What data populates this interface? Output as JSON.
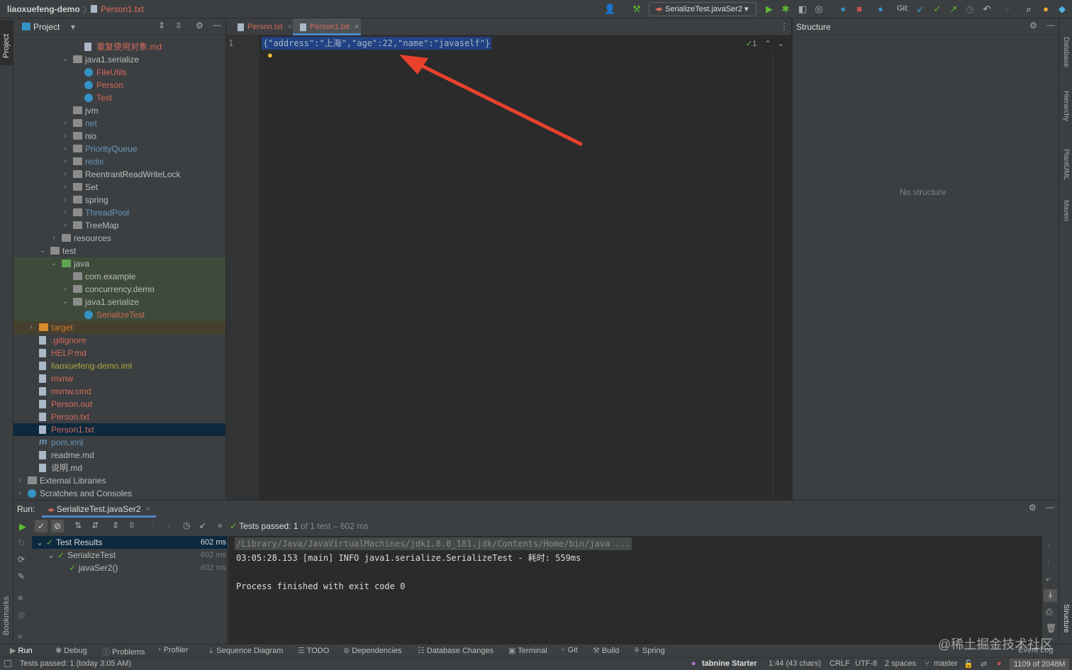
{
  "titlebar": {
    "project": "liaoxuefeng-demo",
    "file": "Person1.txt",
    "run_config": "SerializeTest.javaSer2",
    "git_label": "Git:"
  },
  "sidebar_left": {
    "project_label": "Project",
    "bookmarks_label": "Bookmarks"
  },
  "sidebar_right": {
    "database": "Database",
    "hierarchy": "Hierarchy",
    "plantuml": "PlantUML",
    "maven": "Maven",
    "structure": "Structure"
  },
  "project_panel": {
    "title": "Project",
    "tree": [
      {
        "label": "重复使用对象.md",
        "color": "#d36a5c",
        "kind": "doc"
      },
      {
        "label": "java1.serialize",
        "color": "#bbbbbb",
        "kind": "folder"
      },
      {
        "label": "FileUtils",
        "color": "#d36a5c",
        "kind": "class"
      },
      {
        "label": "Person",
        "color": "#d36a5c",
        "kind": "class"
      },
      {
        "label": "Test",
        "color": "#d36a5c",
        "kind": "class"
      },
      {
        "label": "jvm",
        "color": "#bbbbbb",
        "kind": "folder"
      },
      {
        "label": "net",
        "color": "#6897bb",
        "kind": "folder"
      },
      {
        "label": "nio",
        "color": "#bbbbbb",
        "kind": "folder"
      },
      {
        "label": "PriorityQueue",
        "color": "#6897bb",
        "kind": "folder"
      },
      {
        "label": "redis",
        "color": "#6897bb",
        "kind": "folder"
      },
      {
        "label": "ReentrantReadWriteLock",
        "color": "#bbbbbb",
        "kind": "folder"
      },
      {
        "label": "Set",
        "color": "#bbbbbb",
        "kind": "folder"
      },
      {
        "label": "spring",
        "color": "#bbbbbb",
        "kind": "folder"
      },
      {
        "label": "ThreadPool",
        "color": "#6897bb",
        "kind": "folder"
      },
      {
        "label": "TreeMap",
        "color": "#bbbbbb",
        "kind": "folder"
      },
      {
        "label": "resources",
        "color": "#bbbbbb",
        "kind": "folder"
      },
      {
        "label": "test",
        "color": "#bbbbbb",
        "kind": "folder"
      },
      {
        "label": "java",
        "color": "#bbbbbb",
        "kind": "folder"
      },
      {
        "label": "com.example",
        "color": "#bbbbbb",
        "kind": "folder"
      },
      {
        "label": "concurrency.demo",
        "color": "#bbbbbb",
        "kind": "folder"
      },
      {
        "label": "java1.serialize",
        "color": "#bbbbbb",
        "kind": "folder"
      },
      {
        "label": "SerializeTest",
        "color": "#d36a5c",
        "kind": "class"
      },
      {
        "label": "target",
        "color": "#d07a28",
        "kind": "folder"
      },
      {
        "label": ".gitignore",
        "color": "#d36a5c",
        "kind": "doc"
      },
      {
        "label": "HELP.md",
        "color": "#d36a5c",
        "kind": "doc"
      },
      {
        "label": "liaoxuefeng-demo.iml",
        "color": "#a8a841",
        "kind": "doc"
      },
      {
        "label": "mvnw",
        "color": "#d36a5c",
        "kind": "doc"
      },
      {
        "label": "mvnw.cmd",
        "color": "#d36a5c",
        "kind": "doc"
      },
      {
        "label": "Person.out",
        "color": "#d36a5c",
        "kind": "doc"
      },
      {
        "label": "Person.txt",
        "color": "#d36a5c",
        "kind": "doc"
      },
      {
        "label": "Person1.txt",
        "color": "#d36a5c",
        "kind": "doc"
      },
      {
        "label": "pom.xml",
        "color": "#6897bb",
        "kind": "maven"
      },
      {
        "label": "readme.md",
        "color": "#bbbbbb",
        "kind": "doc"
      },
      {
        "label": "说明.md",
        "color": "#bbbbbb",
        "kind": "doc"
      },
      {
        "label": "External Libraries",
        "color": "#bbbbbb",
        "kind": "lib"
      },
      {
        "label": "Scratches and Consoles",
        "color": "#bbbbbb",
        "kind": "scratch"
      }
    ]
  },
  "editor": {
    "tabs": [
      {
        "label": "Person.txt"
      },
      {
        "label": "Person1.txt"
      }
    ],
    "line_number": "1",
    "code_line": "{\"address\":\"上海\",\"age\":22,\"name\":\"javaself\"}",
    "inspection_count": "1"
  },
  "structure_panel": {
    "title": "Structure",
    "empty_text": "No structure"
  },
  "run_panel": {
    "label": "Run:",
    "config_tab": "SerializeTest.javaSer2",
    "status_passed": "Tests passed:",
    "status_count": "1",
    "status_detail": "of 1 test – 602 ms",
    "tests": [
      {
        "name": "Test Results",
        "time": "602 ms"
      },
      {
        "name": "SerializeTest",
        "time": "602 ms"
      },
      {
        "name": "javaSer2()",
        "time": "602 ms"
      }
    ],
    "console_lines": [
      "/Library/Java/JavaVirtualMachines/jdk1.8.0_181.jdk/Contents/Home/bin/java ...",
      "03:05:28.153 [main] INFO java1.serialize.SerializeTest - 耗时: 559ms",
      "",
      "Process finished with exit code 0"
    ]
  },
  "bottom_tabs": [
    "Run",
    "Debug",
    "Problems",
    "Profiler",
    "Sequence Diagram",
    "TODO",
    "Dependencies",
    "Database Changes",
    "Terminal",
    "Git",
    "Build",
    "Spring"
  ],
  "event_log": "Event Log",
  "statusbar": {
    "message": "Tests passed: 1 (today 3:05 AM)",
    "tabnine": "tabnine Starter",
    "position": "1:44 (43 chars)",
    "line_sep": "CRLF",
    "encoding": "UTF-8",
    "indent": "2 spaces",
    "branch": "master",
    "memory": "1109 of 2048M"
  },
  "watermark": "@稀土掘金技术社区",
  "colors": {
    "accent_blue": "#214283",
    "pass_green": "#5fb832",
    "arrow_red": "#e8412c",
    "selection": "#0d293e"
  }
}
